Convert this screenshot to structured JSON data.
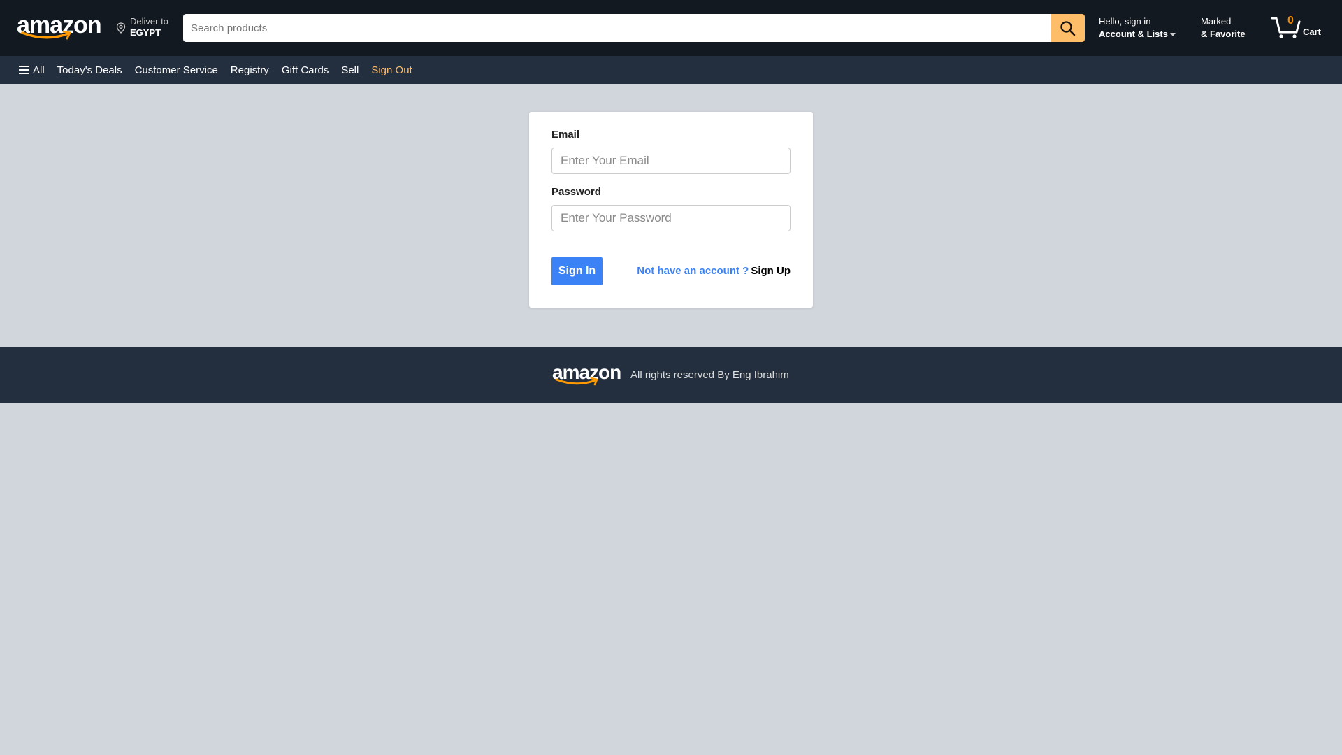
{
  "header": {
    "logo": "amazon",
    "deliver_to_label": "Deliver to",
    "deliver_to_value": "EGYPT",
    "search_placeholder": "Search products",
    "account_line1": "Hello, sign in",
    "account_line2": "Account & Lists",
    "marked_line1": "Marked",
    "marked_line2": "& Favorite",
    "cart_count": "0",
    "cart_label": "Cart",
    "colors": {
      "bg": "#131921",
      "search_button": "#febd69"
    }
  },
  "nav": {
    "items": [
      {
        "label": "All"
      },
      {
        "label": "Today's Deals"
      },
      {
        "label": "Customer Service"
      },
      {
        "label": "Registry"
      },
      {
        "label": "Gift Cards"
      },
      {
        "label": "Sell"
      },
      {
        "label": "Sign Out"
      }
    ],
    "colors": {
      "bg": "#232f3e",
      "signout": "#febd69"
    }
  },
  "form": {
    "email_label": "Email",
    "email_placeholder": "Enter Your Email",
    "password_label": "Password",
    "password_placeholder": "Enter Your Password",
    "signin_button": "Sign In",
    "signup_question": "Not have an account ?",
    "signup_link": "Sign Up",
    "colors": {
      "primary": "#3b82f6"
    }
  },
  "footer": {
    "logo": "amazon",
    "text": "All rights reserved By Eng Ibrahim"
  }
}
